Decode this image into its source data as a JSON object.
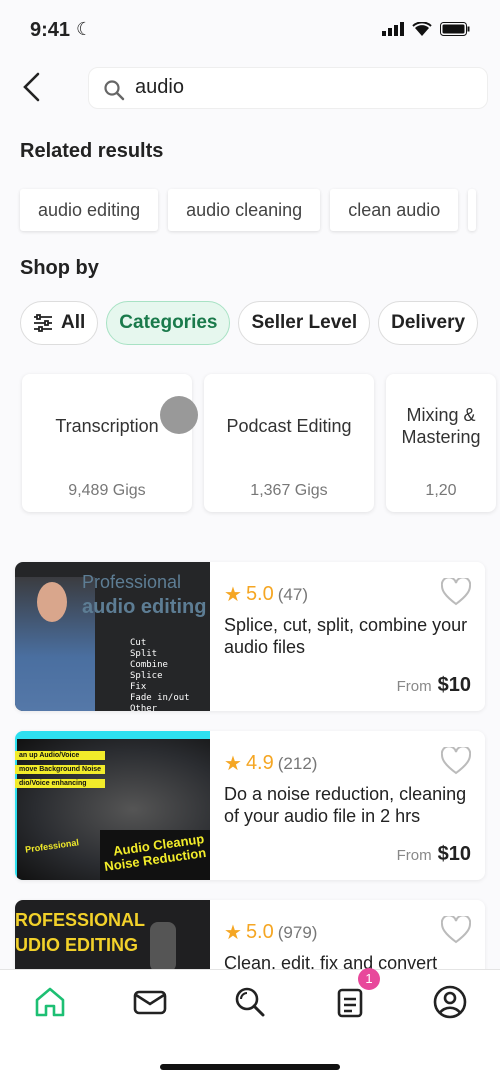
{
  "status": {
    "time": "9:41"
  },
  "search": {
    "value": "audio"
  },
  "related": {
    "heading": "Related results",
    "chips": [
      "audio editing",
      "audio cleaning",
      "clean audio"
    ]
  },
  "shop_by": {
    "heading": "Shop by",
    "filters": [
      {
        "label": "All",
        "active": false
      },
      {
        "label": "Categories",
        "active": true
      },
      {
        "label": "Seller Level",
        "active": false
      },
      {
        "label": "Delivery",
        "active": false
      }
    ]
  },
  "categories": [
    {
      "title": "Transcription",
      "count": "9,489 Gigs"
    },
    {
      "title": "Podcast Editing",
      "count": "1,367 Gigs"
    },
    {
      "title": "Mixing & Mastering",
      "count": "1,20"
    }
  ],
  "gigs": [
    {
      "rating": "5.0",
      "reviews": "(47)",
      "title": "Splice, cut, split, combine your audio files",
      "from": "From",
      "price": "$10",
      "thumb": {
        "line1": "Professional",
        "line2": "audio editing",
        "list": "Cut\nSplit\nCombine\nSplice\nFix\nFade in/out\nOther"
      }
    },
    {
      "rating": "4.9",
      "reviews": "(212)",
      "title": "Do a noise reduction, cleaning of your audio file in 2 hrs",
      "from": "From",
      "price": "$10",
      "thumb": {
        "tags": [
          "an up Audio/Voice",
          "move Background Noise",
          "dio/Voice enhancing"
        ],
        "small": "Professional",
        "big": "Audio Cleanup\nNoise Reduction"
      }
    },
    {
      "rating": "5.0",
      "reviews": "(979)",
      "title": "Clean, edit, fix and convert",
      "from": "",
      "price": "",
      "thumb": {
        "line1": "ROFESSIONAL",
        "line2": "UDIO EDITING"
      }
    }
  ],
  "nav": {
    "badge": "1",
    "active": "home"
  },
  "colors": {
    "accent": "#1dbf73",
    "star": "#f5a623",
    "badge": "#e8489b"
  }
}
